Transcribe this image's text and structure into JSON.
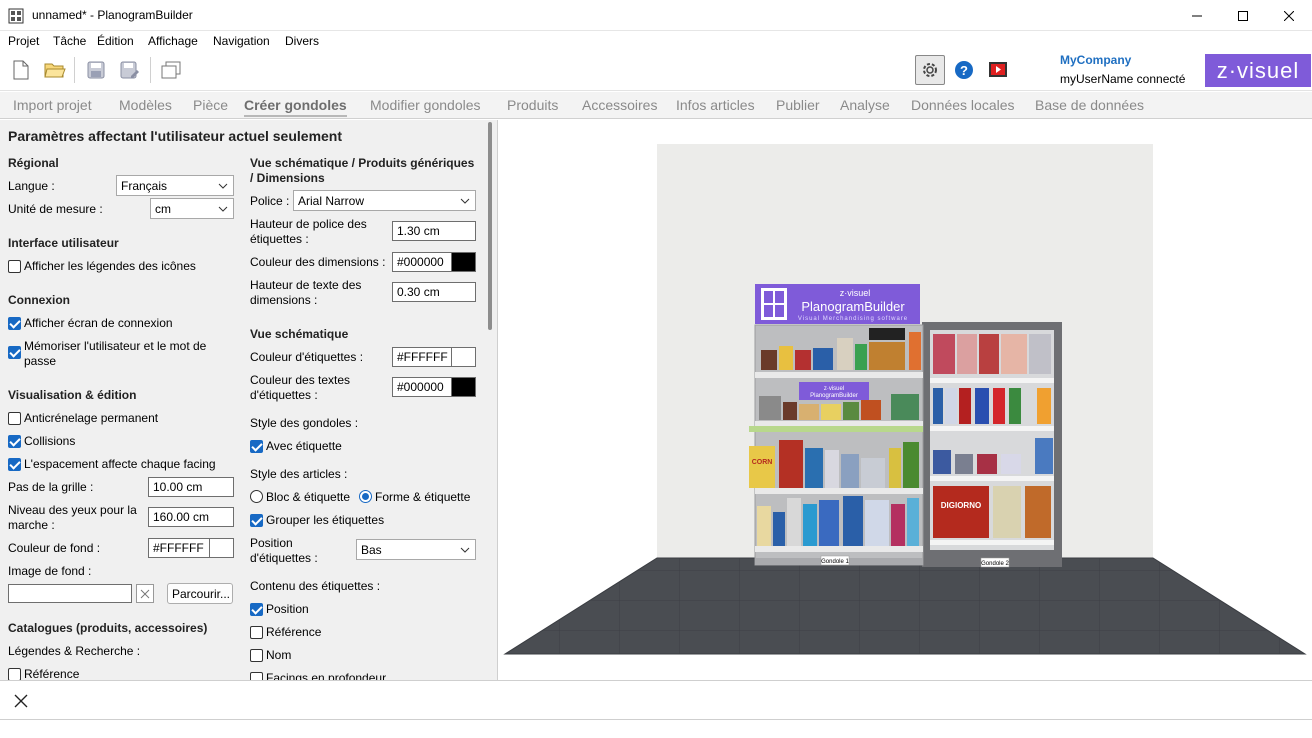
{
  "window": {
    "title": "unnamed* - PlanogramBuilder"
  },
  "menu": [
    "Projet",
    "Tâche",
    "Édition",
    "Affichage",
    "Navigation",
    "Divers"
  ],
  "header": {
    "company": "MyCompany",
    "user_status": "myUserName connecté",
    "logo_text": "z·visuel"
  },
  "tabs": [
    {
      "label": "Import projet"
    },
    {
      "label": "Modèles"
    },
    {
      "label": "Pièce"
    },
    {
      "label": "Créer gondoles",
      "active": true
    },
    {
      "label": "Modifier gondoles"
    },
    {
      "label": "Produits"
    },
    {
      "label": "Accessoires"
    },
    {
      "label": "Infos articles"
    },
    {
      "label": "Publier"
    },
    {
      "label": "Analyse"
    },
    {
      "label": "Données locales"
    },
    {
      "label": "Base de données"
    }
  ],
  "panel": {
    "title": "Paramètres affectant l'utilisateur actuel seulement",
    "left": {
      "regional": "Régional",
      "langue_label": "Langue :",
      "langue_value": "Français",
      "unite_label": "Unité de mesure :",
      "unite_value": "cm",
      "interface": "Interface utilisateur",
      "afficher_legendes": "Afficher les légendes des icônes",
      "connexion": "Connexion",
      "afficher_ecran": "Afficher écran de connexion",
      "memoriser": "Mémoriser l'utilisateur et le mot de passe",
      "visualisation": "Visualisation & édition",
      "anticrenelage": "Anticrénelage permanent",
      "collisions": "Collisions",
      "espacement": "L'espacement affecte chaque facing",
      "pas_label": "Pas de la grille :",
      "pas_value": "10.00 cm",
      "niveau_label": "Niveau des yeux pour la marche :",
      "niveau_value": "160.00 cm",
      "couleur_fond_label": "Couleur de fond :",
      "couleur_fond_value": "#FFFFFF",
      "image_fond_label": "Image de fond :",
      "parcourir": "Parcourir...",
      "catalogues": "Catalogues (produits, accessoires)",
      "legendes_recherche": "Légendes & Recherche :",
      "reference": "Référence"
    },
    "right": {
      "vue_generique": "Vue schématique / Produits génériques / Dimensions",
      "police_label": "Police :",
      "police_value": "Arial Narrow",
      "hauteur_police_label": "Hauteur de police des étiquettes :",
      "hauteur_police_value": "1.30 cm",
      "couleur_dim_label": "Couleur des dimensions :",
      "couleur_dim_value": "#000000",
      "hauteur_texte_label": "Hauteur de texte des dimensions :",
      "hauteur_texte_value": "0.30 cm",
      "vue_schematique": "Vue schématique",
      "couleur_etiq_label": "Couleur d'étiquettes :",
      "couleur_etiq_value": "#FFFFFF",
      "couleur_textes_label": "Couleur des textes d'étiquettes :",
      "couleur_textes_value": "#000000",
      "style_gondoles": "Style des gondoles :",
      "avec_etiquette": "Avec étiquette",
      "style_articles": "Style des articles :",
      "bloc_etiquette": "Bloc & étiquette",
      "forme_etiquette": "Forme & étiquette",
      "grouper": "Grouper les étiquettes",
      "position_label": "Position d'étiquettes :",
      "position_value": "Bas",
      "contenu": "Contenu des étiquettes :",
      "position": "Position",
      "reference": "Référence",
      "nom": "Nom",
      "facings": "Facings en profondeur"
    }
  },
  "scene": {
    "sign_brand": "z·visuel",
    "sign_title": "PlanogramBuilder",
    "sign_sub": "Visual Merchandising software",
    "small_sign_brand": "z·visuel",
    "small_sign_title": "PlanogramBuilder",
    "gondola1": "Gondole 1",
    "gondola2": "Gondole 2"
  },
  "colors": {
    "accent": "#1769c4",
    "brand": "#7f5bd9",
    "company": "#1f6fc1"
  }
}
